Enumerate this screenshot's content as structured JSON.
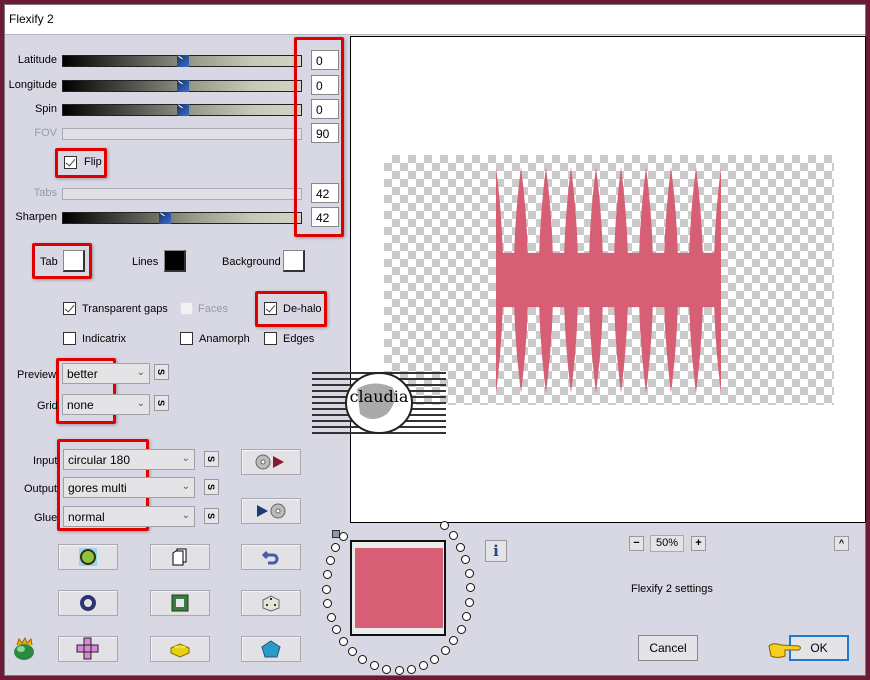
{
  "window": {
    "title": "Flexify 2"
  },
  "sliders": [
    {
      "label": "Latitude",
      "value": "0",
      "fraction": 0.5,
      "disabled": false
    },
    {
      "label": "Longitude",
      "value": "0",
      "fraction": 0.5,
      "disabled": false
    },
    {
      "label": "Spin",
      "value": "0",
      "fraction": 0.5,
      "disabled": false
    },
    {
      "label": "FOV",
      "value": "90",
      "fraction": null,
      "disabled": true
    },
    {
      "label": "Tabs",
      "value": "42",
      "fraction": null,
      "disabled": true
    },
    {
      "label": "Sharpen",
      "value": "42",
      "fraction": 0.42,
      "disabled": false
    }
  ],
  "flip": {
    "label": "Flip",
    "checked": true
  },
  "colors": {
    "tab": {
      "label": "Tab",
      "color": "#ffffff"
    },
    "lines": {
      "label": "Lines",
      "color": "#000000"
    },
    "background": {
      "label": "Background",
      "color": "#ffffff"
    }
  },
  "options": {
    "transparent_gaps": {
      "label": "Transparent gaps",
      "checked": true
    },
    "faces": {
      "label": "Faces",
      "checked": false,
      "disabled": true
    },
    "dehalo": {
      "label": "De-halo",
      "checked": true
    },
    "indicatrix": {
      "label": "Indicatrix",
      "checked": false
    },
    "anamorph": {
      "label": "Anamorph",
      "checked": false
    },
    "edges": {
      "label": "Edges",
      "checked": false
    }
  },
  "dropdowns": {
    "preview": {
      "label": "Preview",
      "value": "better"
    },
    "grid": {
      "label": "Grid",
      "value": "none"
    },
    "input": {
      "label": "Input",
      "value": "circular 180"
    },
    "output": {
      "label": "Output",
      "value": "gores multi"
    },
    "glue": {
      "label": "Glue",
      "value": "normal"
    }
  },
  "s_button_label": "S",
  "zoom": {
    "minus": "−",
    "value": "50%",
    "plus": "+"
  },
  "collapse_label": "^",
  "info_label": "i",
  "status_text": "Flexify 2 settings",
  "buttons": {
    "cancel": "Cancel",
    "ok": "OK"
  },
  "watermark": {
    "text": "claudia"
  },
  "preview_image": {
    "color": "#d75f75",
    "gore_count": 9
  },
  "thumbnail": {
    "color": "#d75f75"
  }
}
